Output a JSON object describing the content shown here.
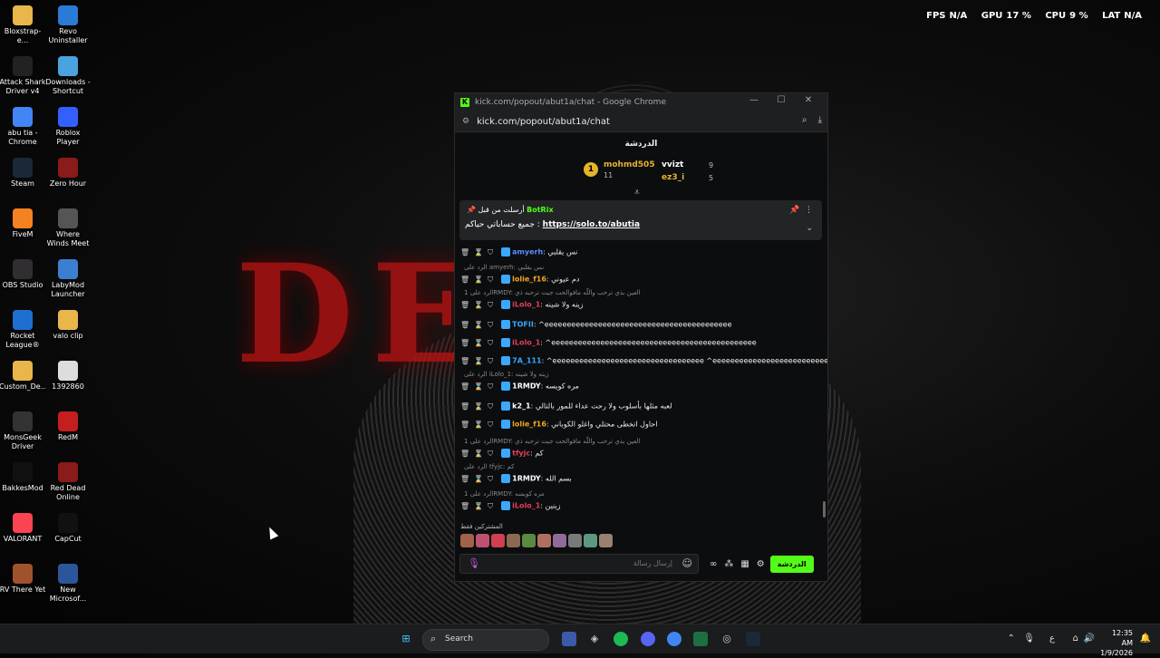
{
  "desktop": {
    "icons": [
      {
        "label": "Bloxstrap-e...",
        "icon": "folder-icon",
        "color": "#e8b64a"
      },
      {
        "label": "Revo Uninstaller",
        "icon": "revo-icon",
        "color": "#2a7bd6"
      },
      {
        "label": "Attack Shark Driver v4",
        "icon": "shark-icon",
        "color": "#222222"
      },
      {
        "label": "Downloads - Shortcut",
        "icon": "download-icon",
        "color": "#4aa3df"
      },
      {
        "label": "abu tia - Chrome",
        "icon": "chrome-icon",
        "color": "#4285f4"
      },
      {
        "label": "Roblox Player",
        "icon": "roblox-icon",
        "color": "#335fff"
      },
      {
        "label": "Steam",
        "icon": "steam-icon",
        "color": "#1b2838"
      },
      {
        "label": "Zero Hour",
        "icon": "zerohour-icon",
        "color": "#8b1a1a"
      },
      {
        "label": "FiveM",
        "icon": "fivem-icon",
        "color": "#f58220"
      },
      {
        "label": "Where Winds Meet",
        "icon": "wwm-icon",
        "color": "#555555"
      },
      {
        "label": "OBS Studio",
        "icon": "obs-icon",
        "color": "#302e31"
      },
      {
        "label": "LabyMod Launcher",
        "icon": "labymod-icon",
        "color": "#3c7fd1"
      },
      {
        "label": "Rocket League®",
        "icon": "rocket-league-icon",
        "color": "#1f6fd1"
      },
      {
        "label": "valo clip",
        "icon": "folder-icon",
        "color": "#e8b64a"
      },
      {
        "label": "Custom_De...",
        "icon": "folder-icon",
        "color": "#e8b64a"
      },
      {
        "label": "1392860",
        "icon": "file-icon",
        "color": "#dddddd"
      },
      {
        "label": "MonsGeek Driver",
        "icon": "monsgeek-icon",
        "color": "#333333"
      },
      {
        "label": "RedM",
        "icon": "redm-icon",
        "color": "#c41e1e"
      },
      {
        "label": "BakkesMod",
        "icon": "bakkesmod-icon",
        "color": "#111111"
      },
      {
        "label": "Red Dead Online",
        "icon": "rdo-icon",
        "color": "#8b1a1a"
      },
      {
        "label": "VALORANT",
        "icon": "valorant-icon",
        "color": "#fa4454"
      },
      {
        "label": "CapCut",
        "icon": "capcut-icon",
        "color": "#111111"
      },
      {
        "label": "RV There Yet",
        "icon": "rv-icon",
        "color": "#a0522d"
      },
      {
        "label": "New Microsof...",
        "icon": "word-icon",
        "color": "#2b579a"
      }
    ]
  },
  "overlay": {
    "fps_label": "FPS",
    "fps_value": "N/A",
    "gpu_label": "GPU",
    "gpu_value": "17 %",
    "cpu_label": "CPU",
    "cpu_value": "9 %",
    "lat_label": "LAT",
    "lat_value": "N/A"
  },
  "browser": {
    "window_title": "kick.com/popout/abut1a/chat - Google Chrome",
    "url": "kick.com/popout/abut1a/chat",
    "accent": "#53fc18"
  },
  "chat": {
    "title": "الدردشة",
    "leaderboard": [
      {
        "rank": "1",
        "name": "mohmd505",
        "value": "11",
        "color": "#e6b32e"
      },
      {
        "name": "vvizt",
        "value": "9",
        "color": "#ffffff"
      },
      {
        "name": "ez3_i",
        "value": "5",
        "color": "#e6b32e"
      }
    ],
    "pinned": {
      "pinned_by_label": "أرسلت من قبل",
      "author": "BotRix",
      "message": "جميع حساباتي حياكم :",
      "link": "https://solo.to/abutia"
    },
    "messages": [
      {
        "user": "amyerh",
        "user_color": "#5b8cff",
        "text": "نس يقلبي"
      },
      {
        "reply": "الرد على amyerh: نس يقلبي"
      },
      {
        "user": "lolie_f16",
        "user_color": "#f5a623",
        "text": "دم عيوني"
      },
      {
        "reply": "الرد على 1RMDY: العين بذي ترحب واللّه مافوالحت جيت ترحبه ذي"
      },
      {
        "user": "iLolo_1",
        "user_color": "#e0405a",
        "text": "زينه ولا شينه"
      },
      {
        "user": "TOFII",
        "user_color": "#3aa8ff",
        "text": "^eeeeeeeeeeeeeeeeeeeeeeeeeeeeeeeeeeeeeeeeee"
      },
      {
        "user": "iLolo_1",
        "user_color": "#e0405a",
        "text": "^eeeeeeeeeeeeeeeeeeeeeeeeeeeeeeeeeeeeeeeeeeeeee"
      },
      {
        "user": "7A_111",
        "user_color": "#3aa8ff",
        "text": "^eeeeeeeeeeeeeeeeeeeeeeeeeeeeeeeeee ^eeeeeeeeeeeeeeeeeeeeeeeeeeeeee"
      },
      {
        "reply": "الرد على iLolo_1: زينه ولا شينه"
      },
      {
        "user": "1RMDY",
        "user_color": "#ffffff",
        "text": "مره كويسه"
      },
      {
        "user": "k2_1",
        "user_color": "#ffffff",
        "text": "لعبه مثلها بأسلوب ولا رحت عداء للمور بالتالي"
      },
      {
        "user": "lolie_f16",
        "user_color": "#f5a623",
        "text": "احاول اتخطى محتلي واغلو الكوباني"
      },
      {
        "reply": "الرد على 1RMDY: العين بذي ترحب واللّه مافوالحت جيت ترحبه ذي"
      },
      {
        "user": "tfyjc",
        "user_color": "#e0405a",
        "text": "كم"
      },
      {
        "reply": "الرد على tfyjc: كم"
      },
      {
        "user": "1RMDY",
        "user_color": "#ffffff",
        "text": "بسم الله"
      },
      {
        "reply": "الرد على 1RMDY: مره كويسه"
      },
      {
        "user": "iLolo_1",
        "user_color": "#e0405a",
        "text": "زينين"
      }
    ],
    "subs_label": "المشتركين فقط",
    "input_placeholder": "إرسال رسالة",
    "chat_button": "الدردشة"
  },
  "taskbar": {
    "search_label": "Search",
    "language": "ع",
    "time": "12:35 AM",
    "date": "1/9/2026"
  }
}
